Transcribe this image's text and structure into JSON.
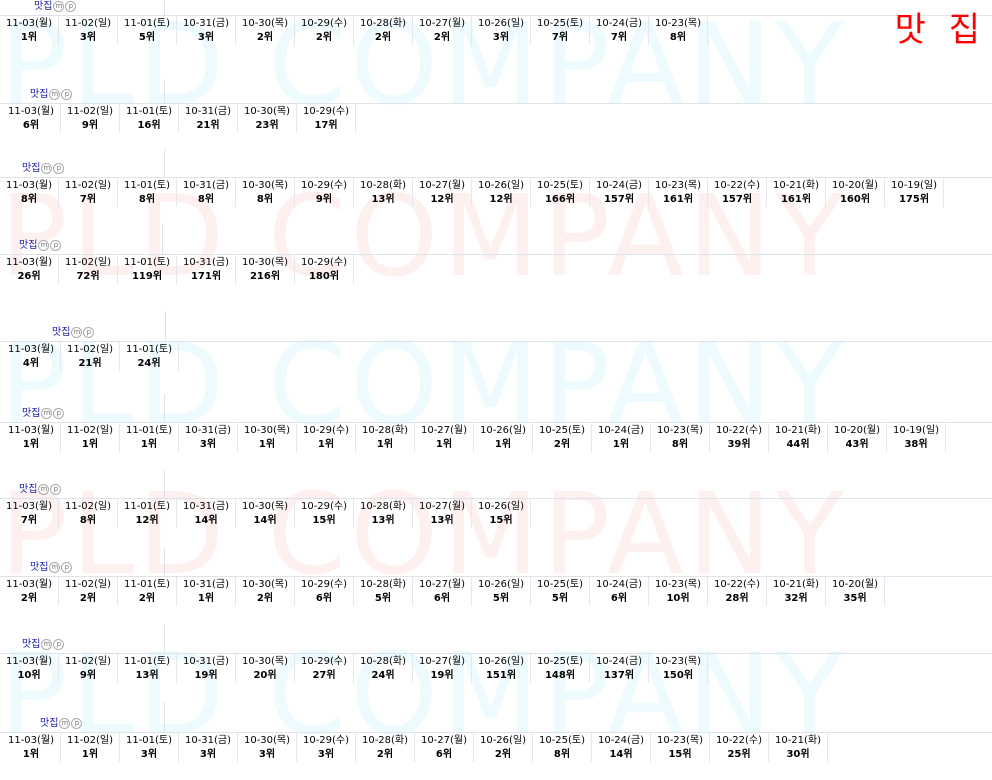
{
  "corner_label": "맛 집",
  "watermark": "PLD COMPANY",
  "rank_suffix": "위",
  "blocks": [
    {
      "keyword": "맛집",
      "badges": [
        "m",
        "p"
      ],
      "dates": [
        "11-03(월)",
        "11-02(일)",
        "11-01(토)",
        "10-31(금)",
        "10-30(목)",
        "10-29(수)",
        "10-28(화)",
        "10-27(월)",
        "10-26(일)",
        "10-25(토)",
        "10-24(금)",
        "10-23(목)"
      ],
      "ranks": [
        "1위",
        "3위",
        "5위",
        "3위",
        "2위",
        "2위",
        "2위",
        "2위",
        "3위",
        "7위",
        "7위",
        "8위"
      ]
    },
    {
      "keyword": "맛집",
      "badges": [
        "m",
        "p"
      ],
      "dates": [
        "11-03(월)",
        "11-02(일)",
        "11-01(토)",
        "10-31(금)",
        "10-30(목)",
        "10-29(수)"
      ],
      "ranks": [
        "6위",
        "9위",
        "16위",
        "21위",
        "23위",
        "17위"
      ]
    },
    {
      "keyword": "맛집",
      "badges": [
        "m",
        "p"
      ],
      "dates": [
        "11-03(월)",
        "11-02(일)",
        "11-01(토)",
        "10-31(금)",
        "10-30(목)",
        "10-29(수)",
        "10-28(화)",
        "10-27(월)",
        "10-26(일)",
        "10-25(토)",
        "10-24(금)",
        "10-23(목)",
        "10-22(수)",
        "10-21(화)",
        "10-20(월)",
        "10-19(일)"
      ],
      "ranks": [
        "8위",
        "7위",
        "8위",
        "8위",
        "8위",
        "9위",
        "13위",
        "12위",
        "12위",
        "166위",
        "157위",
        "161위",
        "157위",
        "161위",
        "160위",
        "175위"
      ]
    },
    {
      "keyword": "맛집",
      "badges": [
        "m",
        "p"
      ],
      "dates": [
        "11-03(월)",
        "11-02(일)",
        "11-01(토)",
        "10-31(금)",
        "10-30(목)",
        "10-29(수)"
      ],
      "ranks": [
        "26위",
        "72위",
        "119위",
        "171위",
        "216위",
        "180위"
      ]
    },
    {
      "keyword": "맛집",
      "badges": [
        "m",
        "p"
      ],
      "dates": [
        "11-03(월)",
        "11-02(일)",
        "11-01(토)"
      ],
      "ranks": [
        "4위",
        "21위",
        "24위"
      ]
    },
    {
      "keyword": "맛집",
      "badges": [
        "m",
        "p"
      ],
      "dates": [
        "11-03(월)",
        "11-02(일)",
        "11-01(토)",
        "10-31(금)",
        "10-30(목)",
        "10-29(수)",
        "10-28(화)",
        "10-27(월)",
        "10-26(일)",
        "10-25(토)",
        "10-24(금)",
        "10-23(목)",
        "10-22(수)",
        "10-21(화)",
        "10-20(월)",
        "10-19(일)"
      ],
      "ranks": [
        "1위",
        "1위",
        "1위",
        "3위",
        "1위",
        "1위",
        "1위",
        "1위",
        "1위",
        "2위",
        "1위",
        "8위",
        "39위",
        "44위",
        "43위",
        "38위"
      ]
    },
    {
      "keyword": "맛집",
      "badges": [
        "m",
        "p"
      ],
      "dates": [
        "11-03(월)",
        "11-02(일)",
        "11-01(토)",
        "10-31(금)",
        "10-30(목)",
        "10-29(수)",
        "10-28(화)",
        "10-27(월)",
        "10-26(일)"
      ],
      "ranks": [
        "7위",
        "8위",
        "12위",
        "14위",
        "14위",
        "15위",
        "13위",
        "13위",
        "15위"
      ]
    },
    {
      "keyword": "맛집",
      "badges": [
        "m",
        "p"
      ],
      "dates": [
        "11-03(월)",
        "11-02(일)",
        "11-01(토)",
        "10-31(금)",
        "10-30(목)",
        "10-29(수)",
        "10-28(화)",
        "10-27(월)",
        "10-26(일)",
        "10-25(토)",
        "10-24(금)",
        "10-23(목)",
        "10-22(수)",
        "10-21(화)",
        "10-20(월)"
      ],
      "ranks": [
        "2위",
        "2위",
        "2위",
        "1위",
        "2위",
        "6위",
        "5위",
        "6위",
        "5위",
        "5위",
        "6위",
        "10위",
        "28위",
        "32위",
        "35위"
      ]
    },
    {
      "keyword": "맛집",
      "badges": [
        "m",
        "p"
      ],
      "dates": [
        "11-03(월)",
        "11-02(일)",
        "11-01(토)",
        "10-31(금)",
        "10-30(목)",
        "10-29(수)",
        "10-28(화)",
        "10-27(월)",
        "10-26(일)",
        "10-25(토)",
        "10-24(금)",
        "10-23(목)"
      ],
      "ranks": [
        "10위",
        "9위",
        "13위",
        "19위",
        "20위",
        "27위",
        "24위",
        "19위",
        "151위",
        "148위",
        "137위",
        "150위"
      ]
    },
    {
      "keyword": "맛집",
      "badges": [
        "m",
        "p"
      ],
      "dates": [
        "11-03(월)",
        "11-02(일)",
        "11-01(토)",
        "10-31(금)",
        "10-30(목)",
        "10-29(수)",
        "10-28(화)",
        "10-27(월)",
        "10-26(일)",
        "10-25(토)",
        "10-24(금)",
        "10-23(목)",
        "10-22(수)",
        "10-21(화)"
      ],
      "ranks": [
        "1위",
        "1위",
        "3위",
        "3위",
        "3위",
        "3위",
        "2위",
        "6위",
        "2위",
        "8위",
        "14위",
        "15위",
        "25위",
        "30위"
      ]
    }
  ]
}
